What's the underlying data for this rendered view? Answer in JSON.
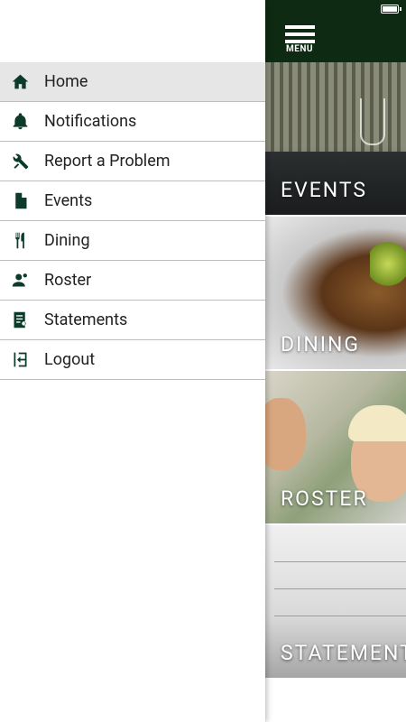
{
  "colors": {
    "topbar": "#0f2a12",
    "icon": "#0d3b2a",
    "active_row": "#e6e6e6",
    "divider": "#bdbdbd"
  },
  "topbar": {
    "menu_label": "MENU"
  },
  "drawer": {
    "items": [
      {
        "label": "Home",
        "icon": "home-icon",
        "active": true
      },
      {
        "label": "Notifications",
        "icon": "bell-icon",
        "active": false
      },
      {
        "label": "Report a Problem",
        "icon": "tools-icon",
        "active": false
      },
      {
        "label": "Events",
        "icon": "document-icon",
        "active": false
      },
      {
        "label": "Dining",
        "icon": "utensils-icon",
        "active": false
      },
      {
        "label": "Roster",
        "icon": "person-icon",
        "active": false
      },
      {
        "label": "Statements",
        "icon": "statement-icon",
        "active": false
      },
      {
        "label": "Logout",
        "icon": "logout-icon",
        "active": false
      }
    ]
  },
  "tiles": [
    {
      "label": "EVENTS"
    },
    {
      "label": "DINING"
    },
    {
      "label": "ROSTER"
    },
    {
      "label": "STATEMENTS"
    }
  ]
}
